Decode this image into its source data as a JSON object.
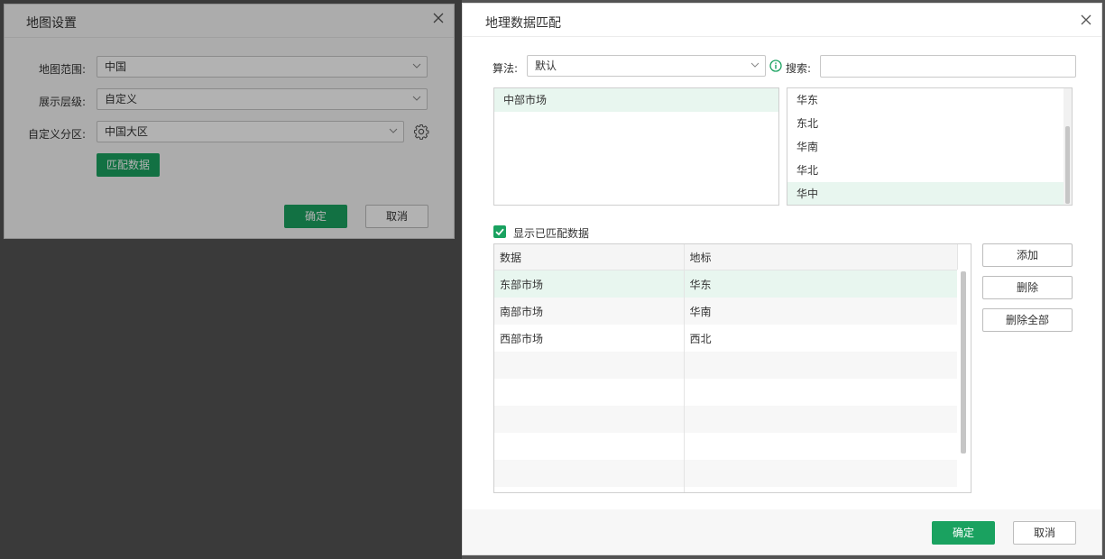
{
  "map_settings": {
    "title": "地图设置",
    "range_label": "地图范围:",
    "range_value": "中国",
    "level_label": "展示层级:",
    "level_value": "自定义",
    "partition_label": "自定义分区:",
    "partition_value": "中国大区",
    "match_button": "匹配数据",
    "ok_button": "确定",
    "cancel_button": "取消"
  },
  "geo_match": {
    "title": "地理数据匹配",
    "algorithm_label": "算法:",
    "algorithm_value": "默认",
    "search_label": "搜索:",
    "search_value": "",
    "unmatched_data": [
      "中部市场"
    ],
    "geo_items": [
      "华东",
      "东北",
      "华南",
      "华北",
      "华中"
    ],
    "selected_geo_index": 4,
    "show_matched_label": "显示已匹配数据",
    "show_matched_checked": true,
    "table": {
      "headers": [
        "数据",
        "地标"
      ],
      "rows": [
        [
          "东部市场",
          "华东"
        ],
        [
          "南部市场",
          "华南"
        ],
        [
          "西部市场",
          "西北"
        ]
      ]
    },
    "add_button": "添加",
    "delete_button": "删除",
    "delete_all_button": "删除全部",
    "ok_button": "确定",
    "cancel_button": "取消"
  },
  "colors": {
    "primary": "#1aa260",
    "selected_row": "#e8f6ef",
    "backdrop": "#535353"
  }
}
